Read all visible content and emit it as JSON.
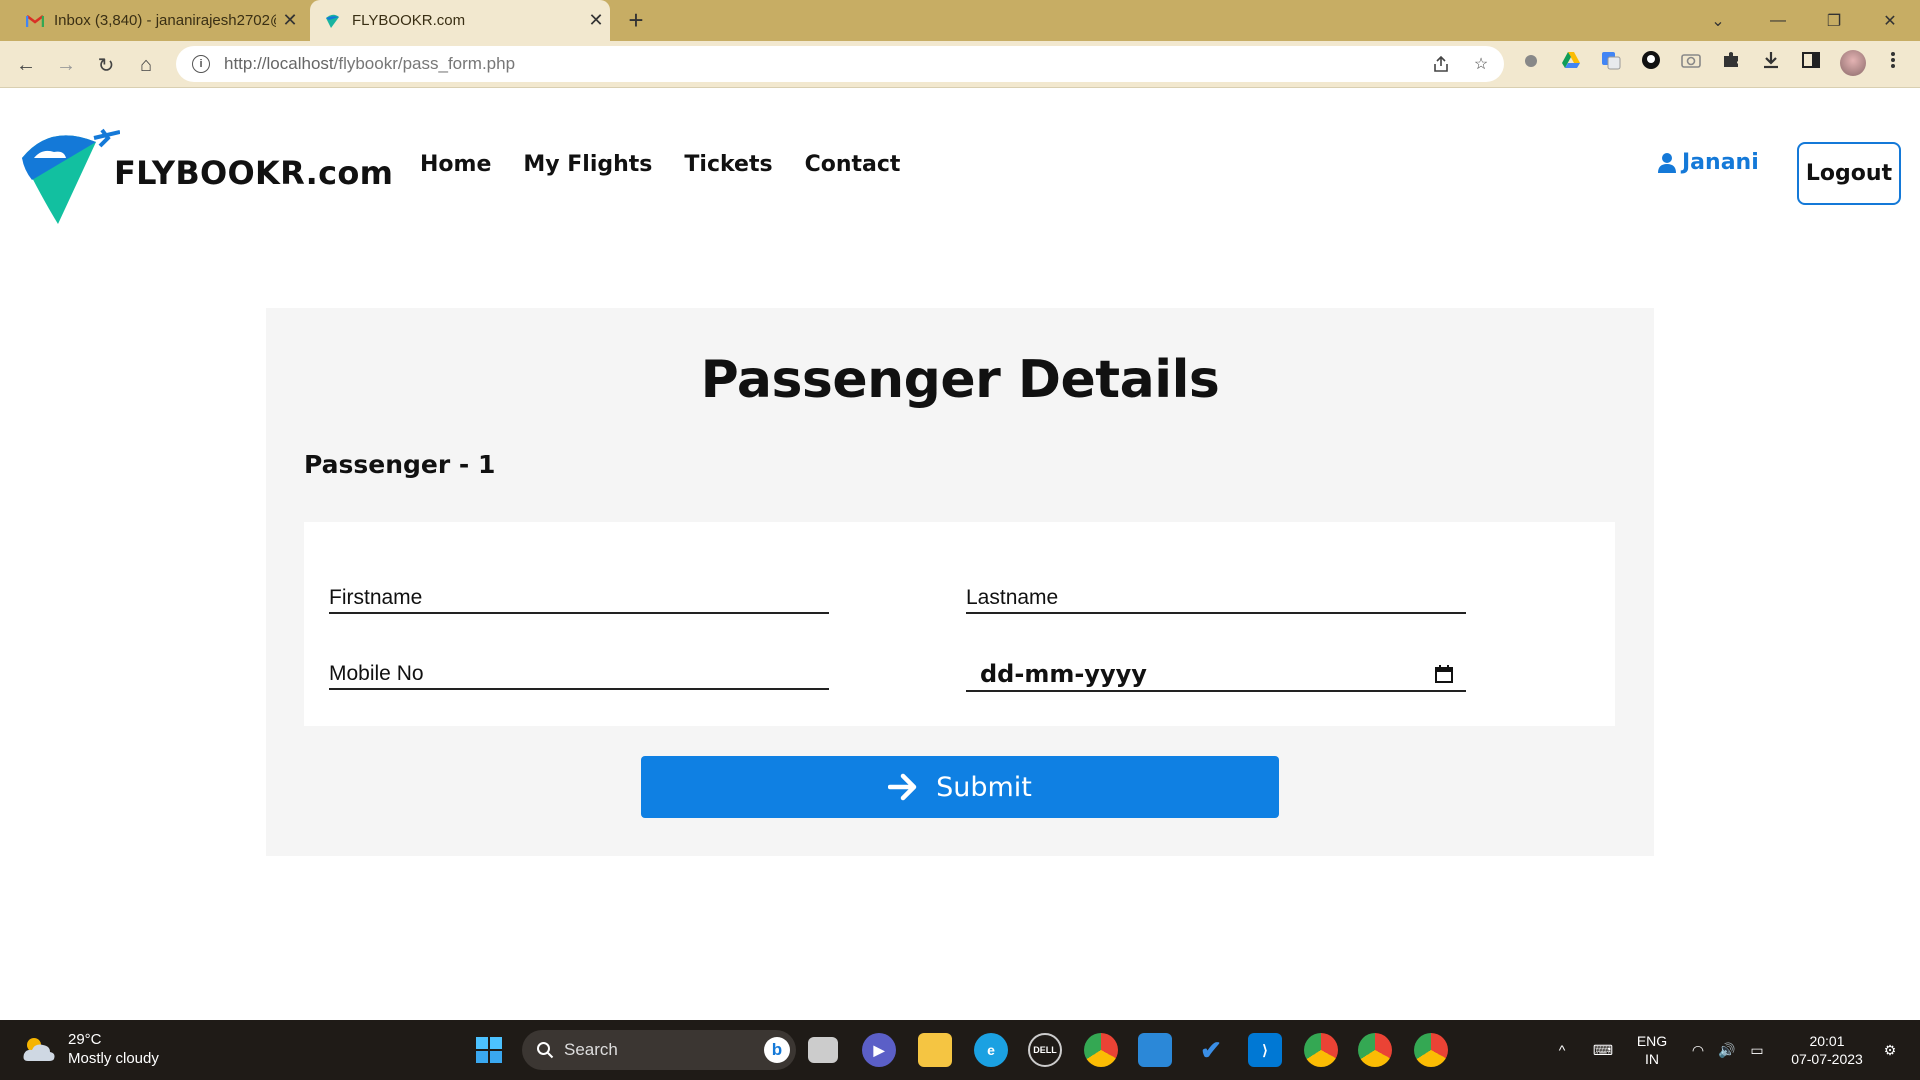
{
  "browser": {
    "tabs": [
      {
        "label": "Inbox (3,840) - jananirajesh2702@",
        "icon": "gmail-icon",
        "active": false
      },
      {
        "label": "FLYBOOKR.com",
        "icon": "plane-favicon",
        "active": true
      }
    ],
    "url_host": "http://localhost",
    "url_path": "/flybookr/pass_form.php"
  },
  "site": {
    "logo_text": "FLYBOOKR.com",
    "nav": [
      "Home",
      "My Flights",
      "Tickets",
      "Contact"
    ],
    "user_name": "Janani",
    "logout_label": "Logout"
  },
  "form": {
    "title": "Passenger Details",
    "passenger_label": "Passenger - 1",
    "firstname_placeholder": "Firstname",
    "lastname_placeholder": "Lastname",
    "mobile_placeholder": "Mobile No",
    "date_placeholder": "dd-mm-yyyy",
    "submit_label": "Submit"
  },
  "taskbar": {
    "temperature": "29°C",
    "weather": "Mostly cloudy",
    "search_label": "Search",
    "lang_line1": "ENG",
    "lang_line2": "IN",
    "time": "20:01",
    "date": "07-07-2023"
  },
  "colors": {
    "accent": "#0f80e3",
    "tab_bar": "#c7ad64",
    "chrome_bg": "#f2e8cf",
    "card_bg": "#f5f5f5"
  }
}
